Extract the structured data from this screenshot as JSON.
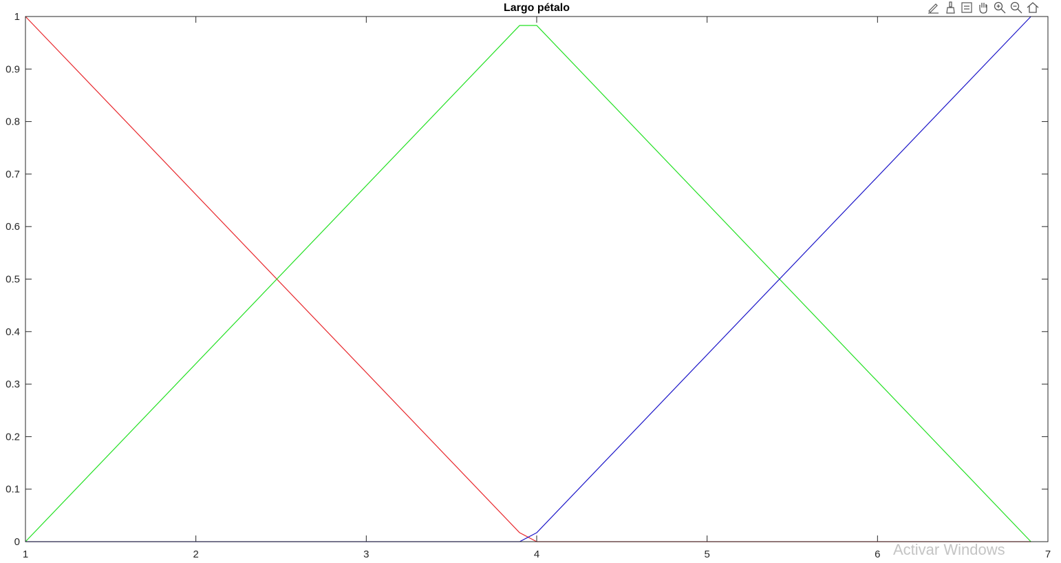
{
  "chart_data": {
    "type": "line",
    "title": "Largo pétalo",
    "xlabel": "",
    "ylabel": "",
    "xlim": [
      1,
      7
    ],
    "ylim": [
      0,
      1
    ],
    "xticks": [
      1,
      2,
      3,
      4,
      5,
      6,
      7
    ],
    "yticks": [
      0,
      0.1,
      0.2,
      0.3,
      0.4,
      0.5,
      0.6,
      0.7,
      0.8,
      0.9,
      1
    ],
    "grid": false,
    "series": [
      {
        "color": "#e8262b",
        "x": [
          1,
          3.9,
          4,
          6.9
        ],
        "y": [
          1,
          0.017,
          0,
          0
        ]
      },
      {
        "color": "#22e022",
        "x": [
          1,
          3.9,
          4,
          6.9
        ],
        "y": [
          0,
          0.983,
          0.983,
          0
        ]
      },
      {
        "color": "#1a14c8",
        "x": [
          1,
          3.9,
          4,
          6.9
        ],
        "y": [
          0,
          0,
          0.017,
          1
        ]
      }
    ]
  },
  "toolbar": {
    "icons": [
      "edit-plot-icon",
      "brush-icon",
      "data-tips-icon",
      "pan-icon",
      "zoom-in-icon",
      "zoom-out-icon",
      "home-icon"
    ]
  },
  "watermark": "Activar Windows"
}
